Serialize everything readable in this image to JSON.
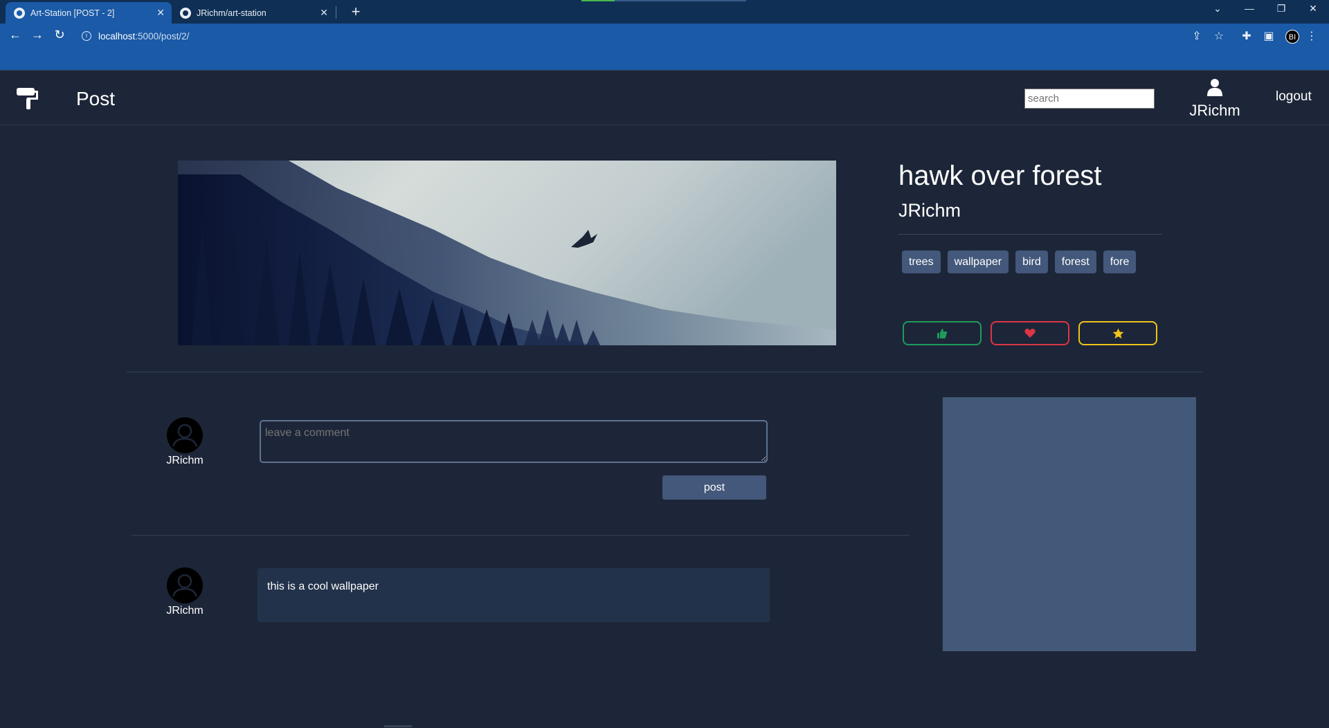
{
  "browser": {
    "tabs": [
      {
        "title": "Art-Station [POST - 2]",
        "close": "✕"
      },
      {
        "title": "JRichm/art-station",
        "close": "✕"
      }
    ],
    "new_tab": "+",
    "url_host": "localhost",
    "url_path": ":5000/post/2/",
    "profile_initials": "BI"
  },
  "navbar": {
    "page_title": "Post",
    "search_placeholder": "search",
    "username": "JRichm",
    "logout_label": "logout"
  },
  "post": {
    "title": "hawk over forest",
    "author": "JRichm",
    "tags": [
      "trees",
      "wallpaper",
      "bird",
      "forest",
      "fore"
    ],
    "reactions": {
      "like_color": "#1e9b5b",
      "love_color": "#dc3545",
      "favorite_color": "#f0c419"
    }
  },
  "comment_form": {
    "avatar_name": "JRichm",
    "placeholder": "leave a comment",
    "post_label": "post"
  },
  "comments": [
    {
      "author": "JRichm",
      "text": "this is a cool wallpaper"
    }
  ],
  "colors": {
    "background": "#1d2638",
    "accent": "#43587a",
    "browser_tab_active": "#1a5aa6"
  }
}
